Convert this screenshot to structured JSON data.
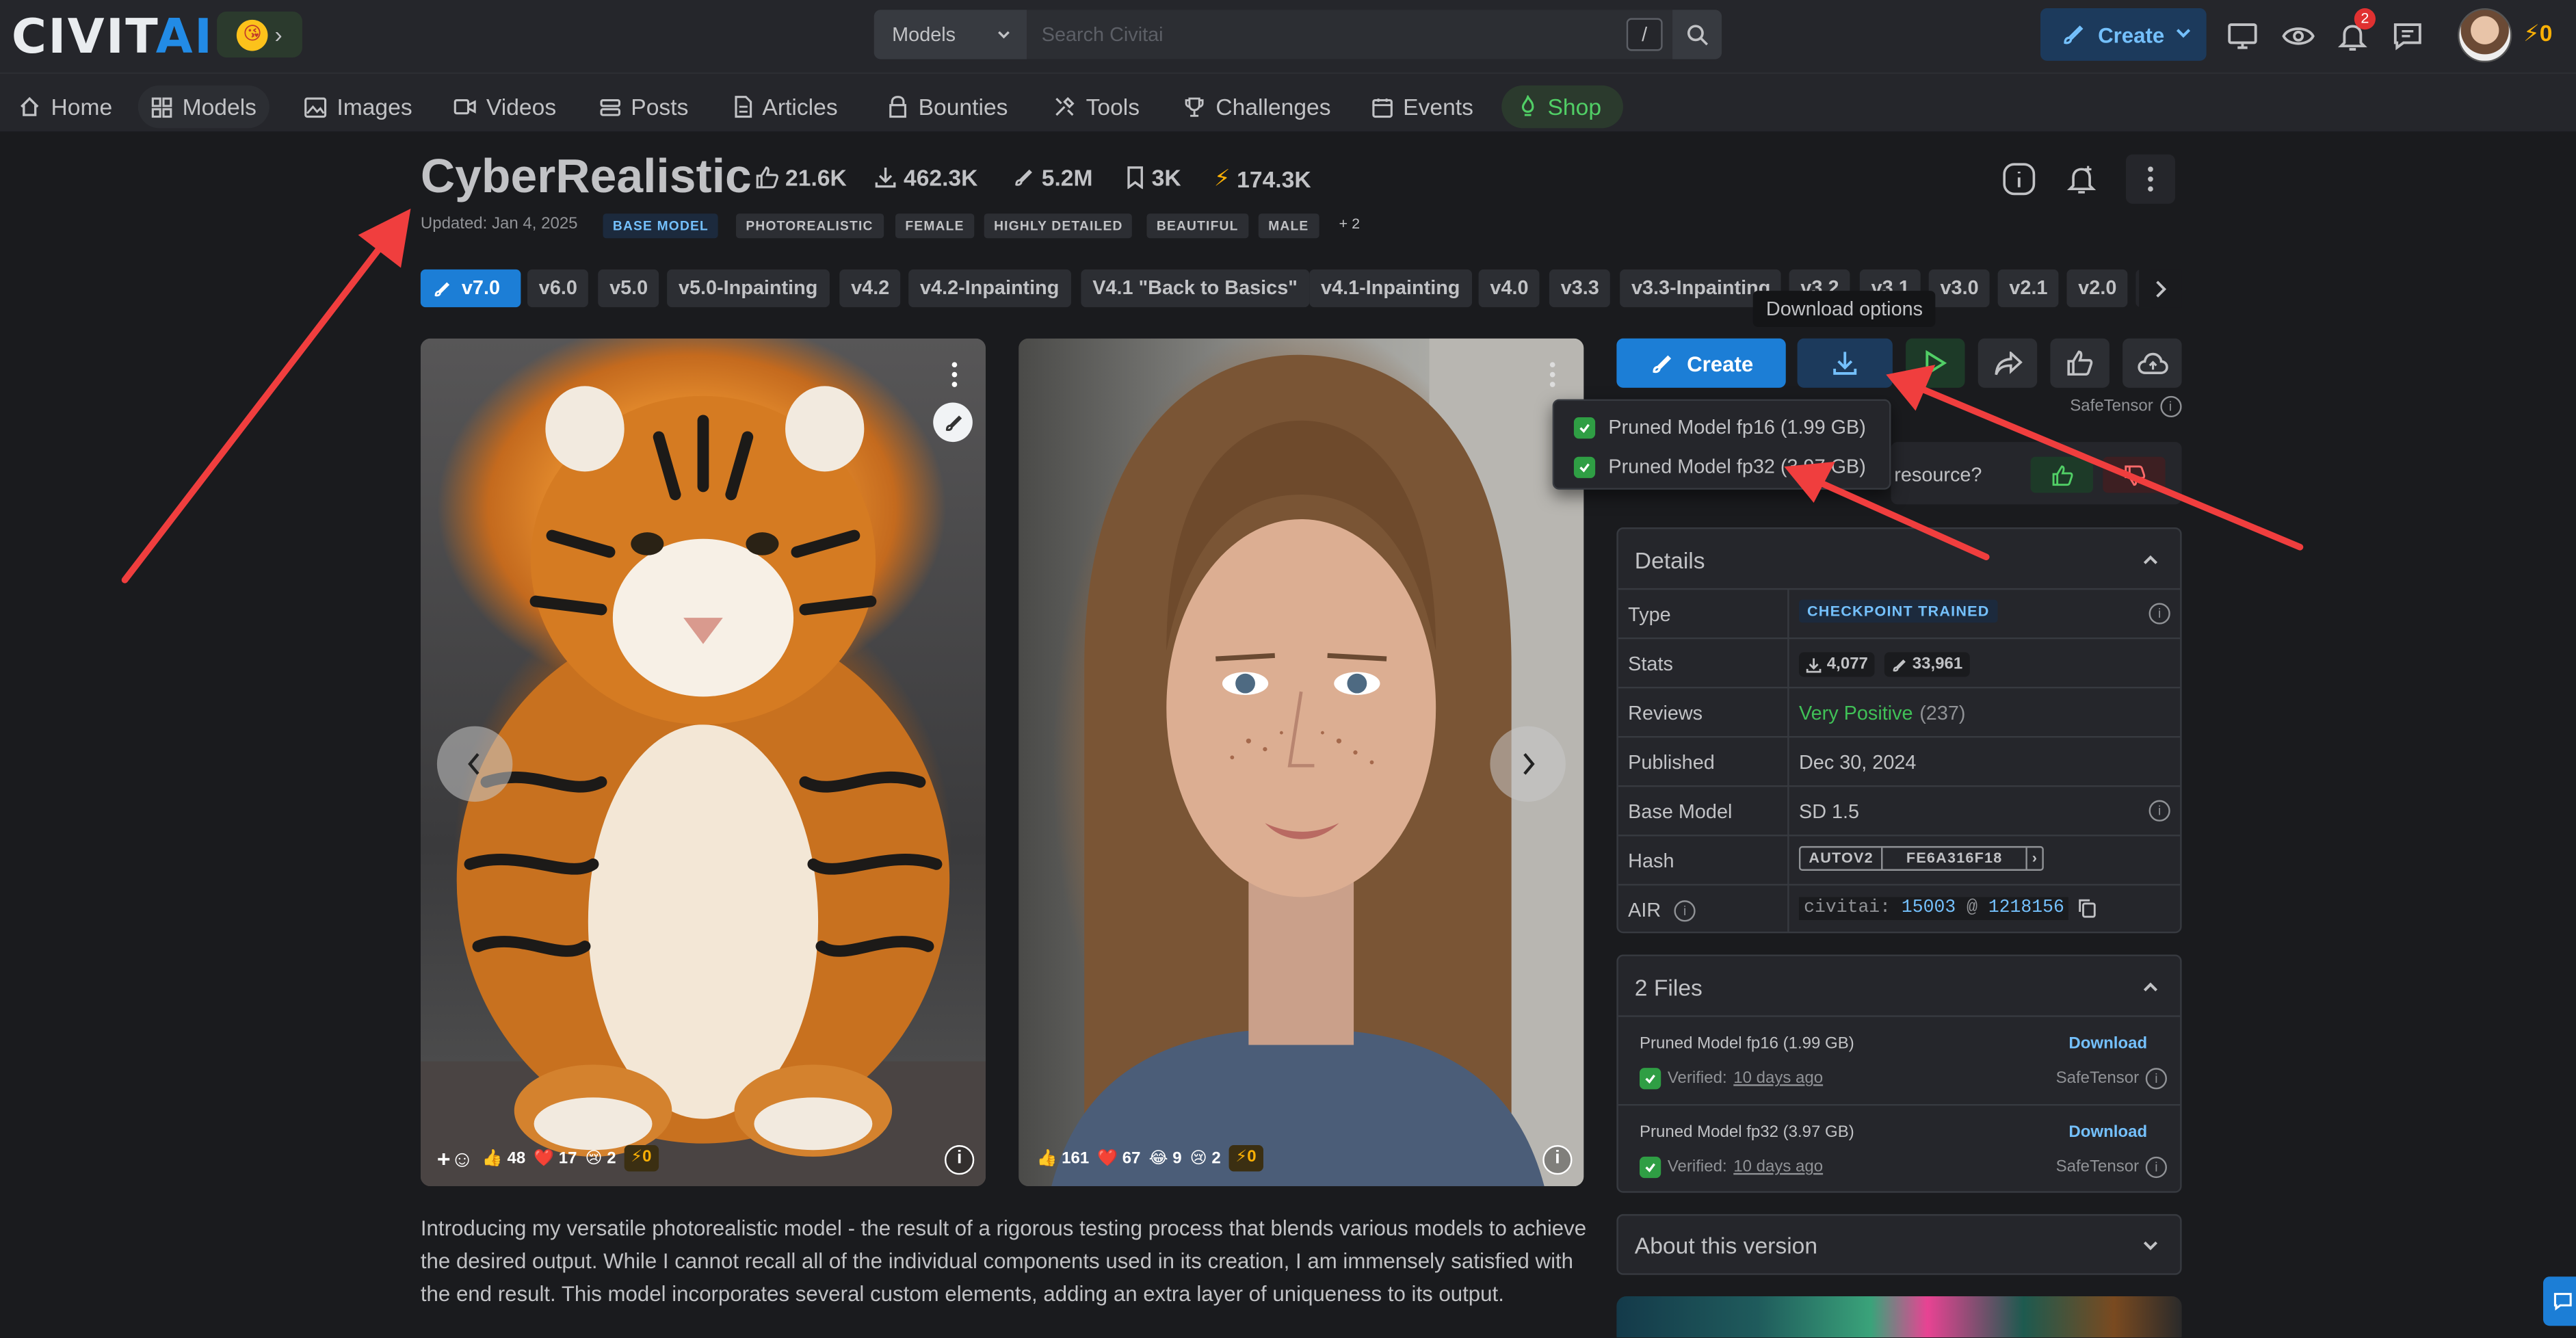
{
  "header": {
    "logo_text_a": "CIVIT",
    "logo_text_b": "AI",
    "emoji": "😘",
    "search_scope": "Models",
    "search_placeholder": "Search Civitai",
    "search_shortcut": "/",
    "create_label": "Create",
    "notification_count": "2",
    "buzz_balance": "0"
  },
  "nav": {
    "items": [
      {
        "label": "Home",
        "icon": "home-icon"
      },
      {
        "label": "Models",
        "icon": "grid-icon"
      },
      {
        "label": "Images",
        "icon": "photo-icon"
      },
      {
        "label": "Videos",
        "icon": "video-icon"
      },
      {
        "label": "Posts",
        "icon": "posts-icon"
      },
      {
        "label": "Articles",
        "icon": "article-icon"
      },
      {
        "label": "Bounties",
        "icon": "bounty-icon"
      },
      {
        "label": "Tools",
        "icon": "tools-icon"
      },
      {
        "label": "Challenges",
        "icon": "trophy-icon"
      },
      {
        "label": "Events",
        "icon": "calendar-icon"
      },
      {
        "label": "Shop",
        "icon": "shop-icon"
      }
    ]
  },
  "model": {
    "title": "CyberRealistic",
    "stats": {
      "likes": "21.6K",
      "downloads": "462.3K",
      "generations": "5.2M",
      "bookmarks": "3K",
      "buzz": "174.3K"
    },
    "updated": "Updated: Jan 4, 2025",
    "tags": [
      "BASE MODEL",
      "PHOTOREALISTIC",
      "FEMALE",
      "HIGHLY DETAILED",
      "BEAUTIFUL",
      "MALE"
    ],
    "more_tags": "+ 2"
  },
  "versions": [
    "v7.0",
    "v6.0",
    "v5.0",
    "v5.0-Inpainting",
    "v4.2",
    "v4.2-Inpainting",
    "V4.1 \"Back to Basics\"",
    "v4.1-Inpainting",
    "v4.0",
    "v3.3",
    "v3.3-Inpainting",
    "v3.2",
    "v3.1",
    "v3.0",
    "v2.1",
    "v2.0",
    "v"
  ],
  "tooltip": "Download options",
  "images": [
    {
      "reactions": {
        "likes": "48",
        "hearts": "17",
        "cry": "2",
        "buzz": "0"
      }
    },
    {
      "reactions": {
        "likes": "161",
        "hearts": "67",
        "laugh": "9",
        "cry": "2",
        "buzz": "0"
      }
    }
  ],
  "description": "Introducing my versatile photorealistic model - the result of a rigorous testing process that blends various models to achieve the desired output. While I cannot recall all of the individual components used in its creation, I am immensely satisfied with the end result. This model incorporates several custom elements, adding an extra layer of uniqueness to its output.",
  "actions": {
    "create_label": "Create",
    "safetensor_label": "SafeTensor"
  },
  "download_menu": [
    "Pruned Model fp16 (1.99 GB)",
    "Pruned Model fp32 (3.97 GB)"
  ],
  "review_prompt": "resource?",
  "details": {
    "header": "Details",
    "rows": {
      "type_label": "Type",
      "type_value": "CHECKPOINT TRAINED",
      "stats_label": "Stats",
      "stats_downloads": "4,077",
      "stats_generations": "33,961",
      "reviews_label": "Reviews",
      "reviews_value": "Very Positive",
      "reviews_count": "(237)",
      "published_label": "Published",
      "published_value": "Dec 30, 2024",
      "base_label": "Base Model",
      "base_value": "SD 1.5",
      "hash_label": "Hash",
      "hash_type": "AUTOV2",
      "hash_value": "FE6A316F18",
      "air_label": "AIR",
      "air_prefix": "civitai:",
      "air_model": "15003",
      "air_at": "@",
      "air_version": "1218156"
    }
  },
  "files": {
    "header": "2 Files",
    "items": [
      {
        "name": "Pruned Model fp16 (1.99 GB)",
        "verified": "Verified:",
        "when": "10 days ago",
        "download": "Download",
        "format": "SafeTensor"
      },
      {
        "name": "Pruned Model fp32 (3.97 GB)",
        "verified": "Verified:",
        "when": "10 days ago",
        "download": "Download",
        "format": "SafeTensor"
      }
    ]
  },
  "about": {
    "header": "About this version"
  },
  "colors": {
    "accent": "#1c7ed6",
    "positive": "#40c057",
    "buzz": "#fab005",
    "annotation": "#f03e3e"
  }
}
